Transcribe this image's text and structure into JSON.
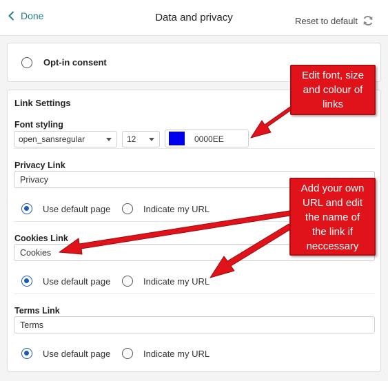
{
  "header": {
    "back_label": "Done",
    "title": "Data and privacy",
    "reset_label": "Reset to default"
  },
  "optin": {
    "label": "Opt-in consent",
    "selected": false
  },
  "link_settings": {
    "title": "Link Settings",
    "font_styling": {
      "label": "Font styling",
      "font": "open_sansregular",
      "size": "12",
      "color_hex": "0000EE",
      "color_swatch": "#0000ee"
    },
    "privacy": {
      "label": "Privacy Link",
      "value": "Privacy",
      "option_default": "Use default page",
      "option_url": "Indicate my URL",
      "selected": "default"
    },
    "cookies": {
      "label": "Cookies Link",
      "value": "Cookies",
      "option_default": "Use default page",
      "option_url": "Indicate my URL",
      "selected": "default"
    },
    "terms": {
      "label": "Terms Link",
      "value": "Terms",
      "option_default": "Use default page",
      "option_url": "Indicate my URL",
      "selected": "default"
    }
  },
  "annotations": {
    "callout_font": [
      "Edit font, size",
      "and colour of",
      "links"
    ],
    "callout_url": [
      "Add your own",
      "URL and edit",
      "the name of",
      "the link if",
      "neccessary"
    ],
    "accent_color": "#e0121a"
  }
}
